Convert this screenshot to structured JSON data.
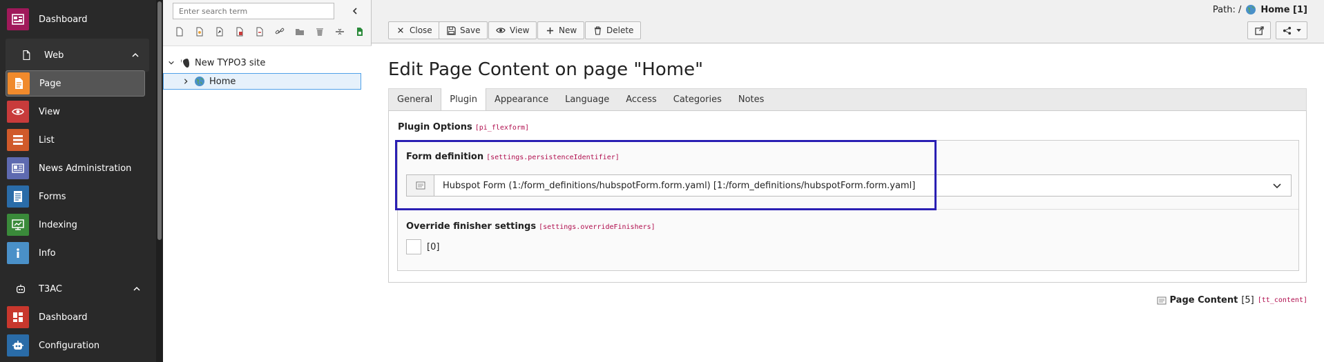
{
  "module_menu": {
    "items": [
      {
        "label": "Dashboard",
        "icon": "dashboard-icon",
        "color": "#a0195a"
      },
      {
        "label": "Web",
        "icon": "web-page-icon",
        "group": true
      },
      {
        "label": "Page",
        "icon": "page-module-icon",
        "color": "#f08a2c",
        "active": true
      },
      {
        "label": "View",
        "icon": "eye-icon",
        "color": "#c83b3b"
      },
      {
        "label": "List",
        "icon": "list-icon",
        "color": "#d05a2a"
      },
      {
        "label": "News Administration",
        "icon": "news-icon",
        "color": "#5e6ab0"
      },
      {
        "label": "Forms",
        "icon": "forms-icon",
        "color": "#2a6ca8"
      },
      {
        "label": "Indexing",
        "icon": "indexing-icon",
        "color": "#3a8a3a"
      },
      {
        "label": "Info",
        "icon": "info-icon",
        "color": "#4a90c8"
      },
      {
        "label": "T3AC",
        "icon": "robot-icon",
        "group": true
      },
      {
        "label": "Dashboard",
        "icon": "t3ac-dashboard-icon",
        "color": "#c8372d"
      },
      {
        "label": "Configuration",
        "icon": "configuration-icon",
        "color": "#2a6ca8"
      }
    ]
  },
  "tree": {
    "search_placeholder": "Enter search term",
    "root_label": "New TYPO3 site",
    "home_label": "Home"
  },
  "docheader": {
    "path_label": "Path: /",
    "path_current": "Home [1]",
    "close_label": "Close",
    "save_label": "Save",
    "view_label": "View",
    "new_label": "New",
    "delete_label": "Delete"
  },
  "main": {
    "title": "Edit Page Content on page \"Home\"",
    "tabs": [
      {
        "label": "General"
      },
      {
        "label": "Plugin",
        "active": true
      },
      {
        "label": "Appearance"
      },
      {
        "label": "Language"
      },
      {
        "label": "Access"
      },
      {
        "label": "Categories"
      },
      {
        "label": "Notes"
      }
    ],
    "plugin_options_label": "Plugin Options",
    "plugin_options_key": "[pi_flexform]",
    "form_definition_label": "Form definition",
    "form_definition_key": "[settings.persistenceIdentifier]",
    "form_definition_value": "Hubspot Form (1:/form_definitions/hubspotForm.form.yaml) [1:/form_definitions/hubspotForm.form.yaml]",
    "override_label": "Override finisher settings",
    "override_key": "[settings.overrideFinishers]",
    "override_checkbox_label": "[0]",
    "record_type": "Page Content",
    "record_uid": "[5]",
    "record_table": "[tt_content]"
  },
  "colors": {
    "highlight": "#2a1fb3",
    "field_key": "#b00d4d",
    "menu_bg": "#292929"
  }
}
